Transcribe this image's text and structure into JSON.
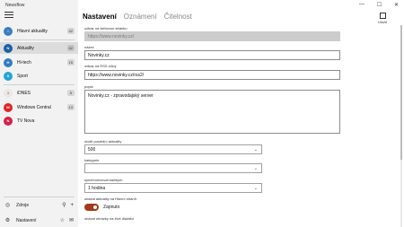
{
  "app": {
    "title": "Newsflow"
  },
  "window": {
    "minimize": "—",
    "maximize": "☐",
    "close": "✕"
  },
  "sidebar": {
    "items": [
      {
        "label": "Hlavní aktuality",
        "badge": "42",
        "icon_color": "#3b7dbf",
        "icon_text": "☆"
      },
      {
        "label": "Aktuality",
        "badge": "42",
        "icon_color": "#1c5fa8",
        "icon_text": "N"
      },
      {
        "label": "Hi-tech",
        "badge": "15",
        "icon_color": "#2e7ec2",
        "icon_text": "H"
      },
      {
        "label": "Sport",
        "badge": "",
        "icon_color": "#1fa3d8",
        "icon_text": "S"
      },
      {
        "label": "iDNES",
        "badge": "5",
        "icon_color": "#e3e3e3",
        "icon_text": "i"
      },
      {
        "label": "Windows Central",
        "badge": "13",
        "icon_color": "#e02424",
        "icon_text": "W"
      },
      {
        "label": "TV Nova",
        "badge": "",
        "icon_color": "#d81e49",
        "icon_text": "N"
      }
    ],
    "sources_label": "Zdroje",
    "settings_label": "Nastavení"
  },
  "tabs": [
    "Nastavení",
    "Oznámení",
    "Čitelnost"
  ],
  "save_label": "Uložit",
  "form": {
    "web_label": "odkaz na webovou stránku",
    "web_value": "https://www.novinky.cz/",
    "name_label": "název",
    "name_value": "Novinky.cz",
    "rss_label": "odkaz na RSS zdroj",
    "rss_value": "https://www.novinky.cz/rss2/",
    "desc_label": "popis",
    "desc_value": "Novinky.cz - zpravodajský server",
    "keep_label": "uložit poslední aktuality",
    "keep_value": "500",
    "category_label": "kategorie",
    "category_value": "",
    "sync_label": "synchronizovat každých",
    "sync_value": "1 hodina",
    "main_news_label": "ukázat aktuality na Hlavní stranů",
    "toggle_label": "Zapnuto",
    "tile_label": "ukázat obrázky na živé dlaždici"
  }
}
